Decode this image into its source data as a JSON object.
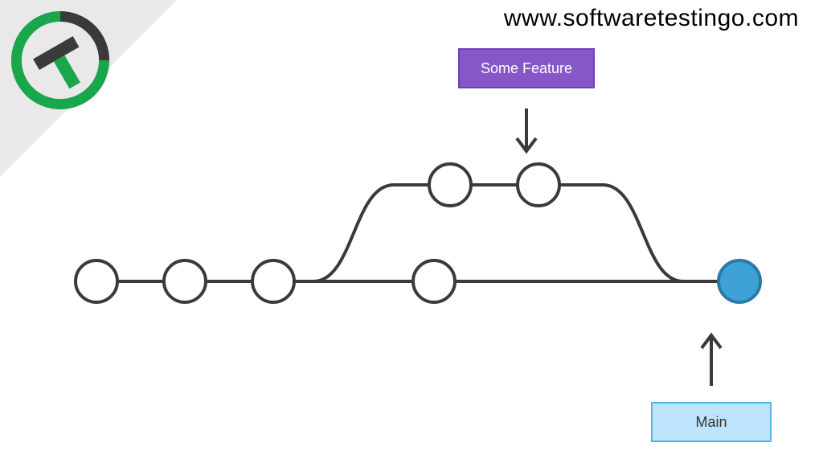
{
  "site_url": "www.softwaretestingo.com",
  "labels": {
    "feature": "Some Feature",
    "main": "Main"
  },
  "diagram": {
    "type": "git-branch-merge",
    "branches": {
      "main": {
        "commits_before_branch": 3,
        "commits_on_main_during_branch": 1,
        "merge_commit_highlighted": true
      },
      "feature": {
        "commits": 2
      }
    },
    "colors": {
      "feature_box": "#8657c6",
      "main_box": "#bde4fb",
      "merge_node": "#3ea2d6",
      "lines": "#3a3a3a",
      "logo_green": "#1aa64b"
    }
  }
}
